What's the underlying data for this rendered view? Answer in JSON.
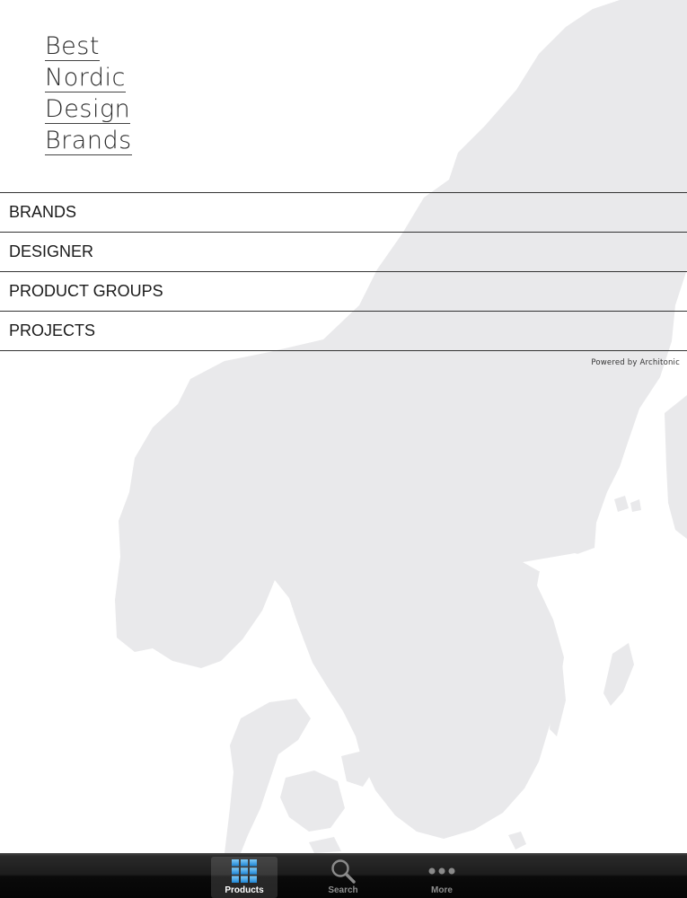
{
  "logo": {
    "lines": [
      "Best",
      "Nordic",
      "Design",
      "Brands"
    ]
  },
  "menu": {
    "items": [
      {
        "label": "BRANDS"
      },
      {
        "label": "DESIGNER"
      },
      {
        "label": "PRODUCT GROUPS"
      },
      {
        "label": "PROJECTS"
      }
    ]
  },
  "footer": {
    "powered_by": "Powered by Architonic"
  },
  "tabbar": {
    "tabs": [
      {
        "label": "Products",
        "icon": "grid-icon",
        "active": true
      },
      {
        "label": "Search",
        "icon": "search-icon",
        "active": false
      },
      {
        "label": "More",
        "icon": "more-dots-icon",
        "active": false
      }
    ]
  },
  "colors": {
    "map": "#e9e9eb",
    "divider": "#333333",
    "tab_active_icon": "#3aa6e6"
  }
}
